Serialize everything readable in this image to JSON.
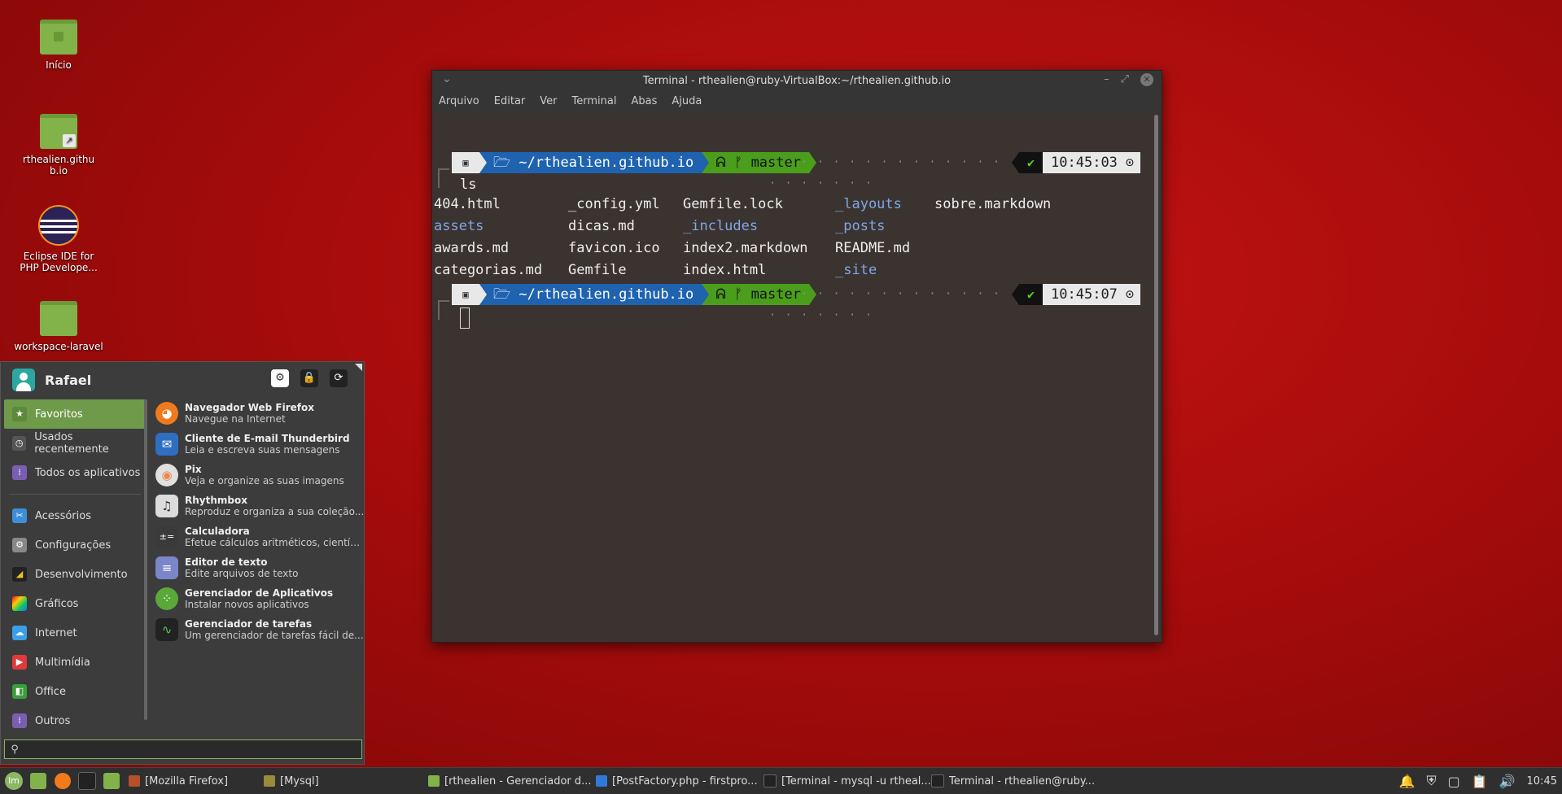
{
  "desktop": {
    "icons": [
      {
        "label": "Início",
        "icon": "home-folder-icon"
      },
      {
        "label": "rthealien.github.io",
        "icon": "folder-link-icon"
      },
      {
        "label": "Eclipse IDE for PHP Develope...",
        "icon": "eclipse-icon"
      },
      {
        "label": "workspace-laravel",
        "icon": "folder-icon"
      }
    ]
  },
  "terminal": {
    "title": "Terminal - rthealien@ruby-VirtualBox:~/rthealien.github.io",
    "menu": [
      "Arquivo",
      "Editar",
      "Ver",
      "Terminal",
      "Abas",
      "Ajuda"
    ],
    "prompt1": {
      "dir": "~/rthealien.github.io",
      "branch": "master",
      "time": "10:45:03"
    },
    "command": "ls",
    "ls_columns": [
      [
        "404.html",
        "assets",
        "awards.md",
        "categorias.md"
      ],
      [
        "_config.yml",
        "dicas.md",
        "favicon.ico",
        "Gemfile"
      ],
      [
        "Gemfile.lock",
        "_includes",
        "index2.markdown",
        "index.html"
      ],
      [
        "_layouts",
        "_posts",
        "README.md",
        "_site"
      ],
      [
        "sobre.markdown"
      ]
    ],
    "directories": [
      "assets",
      "_includes",
      "_layouts",
      "_posts",
      "_site"
    ],
    "prompt2": {
      "dir": "~/rthealien.github.io",
      "branch": "master",
      "time": "10:45:07"
    }
  },
  "start_menu": {
    "user": "Rafael",
    "categories": [
      {
        "label": "Favoritos",
        "active": true,
        "color": "#6e9a4a",
        "icon": "star-icon"
      },
      {
        "label": "Usados recentemente",
        "color": "#555",
        "icon": "clock-icon"
      },
      {
        "label": "Todos os aplicativos",
        "color": "#7a5fb0",
        "icon": "grid-icon"
      },
      {
        "label": "Acessórios",
        "color": "#3d8ed8",
        "icon": "tools-icon"
      },
      {
        "label": "Configurações",
        "color": "#888",
        "icon": "settings-icon"
      },
      {
        "label": "Desenvolvimento",
        "color": "#222",
        "icon": "code-icon"
      },
      {
        "label": "Gráficos",
        "color": "#c83ac8",
        "icon": "graphics-icon"
      },
      {
        "label": "Internet",
        "color": "#3d9ee8",
        "icon": "cloud-icon"
      },
      {
        "label": "Multimídia",
        "color": "#e03a3a",
        "icon": "play-icon"
      },
      {
        "label": "Office",
        "color": "#3a9e3a",
        "icon": "office-icon"
      },
      {
        "label": "Outros",
        "color": "#7a5fb0",
        "icon": "grid-icon"
      }
    ],
    "apps": [
      {
        "name": "Navegador Web Firefox",
        "desc": "Navegue na Internet",
        "color": "#f07a1c",
        "icon": "firefox-icon"
      },
      {
        "name": "Cliente de E-mail Thunderbird",
        "desc": "Leia e escreva suas mensagens",
        "color": "#2f6fc2",
        "icon": "thunderbird-icon"
      },
      {
        "name": "Pix",
        "desc": "Veja e organize as suas imagens",
        "color": "#e0e0e0",
        "icon": "pix-icon"
      },
      {
        "name": "Rhythmbox",
        "desc": "Reproduz e organiza a sua coleção...",
        "color": "#dcdcdc",
        "icon": "rhythmbox-icon"
      },
      {
        "name": "Calculadora",
        "desc": "Efetue cálculos aritméticos, científi...",
        "color": "#3a3a3a",
        "icon": "calculator-icon"
      },
      {
        "name": "Editor de texto",
        "desc": "Edite arquivos de texto",
        "color": "#7a86c8",
        "icon": "text-editor-icon"
      },
      {
        "name": "Gerenciador de Aplicativos",
        "desc": "Instalar novos aplicativos",
        "color": "#5aa83a",
        "icon": "software-manager-icon"
      },
      {
        "name": "Gerenciador de tarefas",
        "desc": "Um gerenciador de tarefas fácil de...",
        "color": "#222",
        "icon": "task-manager-icon"
      }
    ],
    "search_value": ""
  },
  "panel": {
    "tasks": [
      {
        "label": "[Mozilla Firefox]",
        "color": "#b5502a"
      },
      {
        "label": "[Mysql]",
        "color": "#9a8a3a"
      },
      {
        "label": "[rthealien - Gerenciador d...",
        "color": "#82b24a"
      },
      {
        "label": "[PostFactory.php - firstpro...",
        "color": "#2f7ad8"
      },
      {
        "label": "[Terminal - mysql -u rtheal...",
        "color": "#222"
      },
      {
        "label": "Terminal - rthealien@ruby...",
        "color": "#222"
      }
    ],
    "clock": "10:45"
  }
}
